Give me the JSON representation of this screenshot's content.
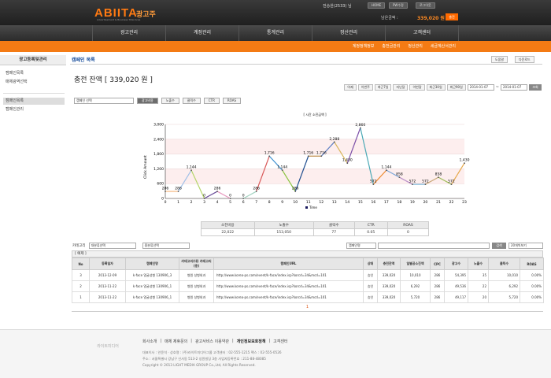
{
  "header": {
    "logo": "ABIITA",
    "logo_sub": "Advertisement & Business Total Area",
    "logo_ko": "광고주",
    "user": "전승완(2533) 님",
    "buttons": [
      "HOME",
      "PW수정",
      "로그아웃"
    ],
    "balance_label": "남은금액 :",
    "balance_value": "339,020 원",
    "charge": "충전"
  },
  "gnb": [
    "광고관리",
    "계정관리",
    "통계관리",
    "정산관리",
    "고객센터"
  ],
  "subnav": [
    "계정정책정보",
    "충전금관리",
    "정산관리",
    "세금계산서관리"
  ],
  "lnb": {
    "title": "광고등록및관리",
    "items": [
      "캠페인목록",
      "매체광역선택",
      "캠페인목록",
      "캠페인관리"
    ]
  },
  "page": {
    "title": "캠페인 목록",
    "util": [
      "도움말",
      "다운로드"
    ],
    "balance": "충전 잔액 [ 339,020 원 ]"
  },
  "dates": {
    "buttons": [
      "어제",
      "이번주",
      "최근7일",
      "지난달",
      "이번달",
      "최근30일",
      "최근90일"
    ],
    "from": "2014-01-07",
    "tilde": "~",
    "to": "2014-01-07",
    "go": "조회"
  },
  "filter": {
    "select": "캠페인 선택",
    "buttons": [
      "광고비용",
      "노출수",
      "클릭수",
      "CTR",
      "ROAS"
    ]
  },
  "chart_data": {
    "type": "line",
    "title": "[ 시간 소진금액 ]",
    "ylabel": "Click Amount",
    "xlabel": "Time",
    "x": [
      0,
      1,
      2,
      3,
      4,
      5,
      6,
      7,
      8,
      9,
      10,
      11,
      12,
      13,
      14,
      15,
      16,
      17,
      18,
      19,
      20,
      21,
      22,
      23
    ],
    "values": [
      286,
      286,
      1144,
      0,
      286,
      0,
      0,
      286,
      1716,
      1144,
      286,
      1716,
      1716,
      2288,
      1430,
      2860,
      572,
      1144,
      858,
      572,
      572,
      858,
      572,
      1430
    ],
    "labels": [
      "286",
      "286",
      "1,144",
      "0",
      "286",
      "0",
      "0",
      "286",
      "1,716",
      "1,144",
      "286",
      "1,716",
      "1,716",
      "2,288",
      "1,430",
      "2,860",
      "572",
      "1,144",
      "858",
      "572",
      "572",
      "858",
      "572",
      "1,430"
    ],
    "yticks": [
      "0",
      "600",
      "1,200",
      "1,800",
      "2,400",
      "3,000"
    ],
    "ylim": [
      0,
      3000
    ],
    "legend": "Time"
  },
  "summary": {
    "headers": [
      "소진비용",
      "노출수",
      "클릭수",
      "CTR",
      "ROAS"
    ],
    "values": [
      "22,022",
      "153,050",
      "77",
      "0.05",
      "0"
    ]
  },
  "list_ctrl": {
    "category_label": "카테고리",
    "category_select": "대분류선택",
    "sub_select": "중분류선택",
    "right_select": "캠페인명",
    "search_btn": "검색",
    "per_page": "20개씩보기"
  },
  "table": {
    "caption": "[ 예제 ]",
    "headers": [
      "No",
      "등록일자",
      "캠페인명",
      "카테고리(대) 카테고리(중)",
      "캠페인URL",
      "상태",
      "충전잔액",
      "일별공소진액",
      "CPC",
      "광고수",
      "노출수",
      "클릭수",
      "ROAS"
    ],
    "rows": [
      [
        "3",
        "2013-12-09",
        "k-face 얼굴성형 130906_3",
        "병원 성형외과",
        "http://www.korea-ps.com/event/k-face/index.isp?korcd=34&mcd=101",
        "승인",
        "339,020",
        "10,010",
        "286",
        "54,395",
        "35",
        "10,010",
        "0.00%"
      ],
      [
        "2",
        "2013-11-22",
        "k-face 얼굴성형 130906_1",
        "병원 성형외과",
        "http://www.korea-ps.com/event/k-face/index.isp?korcd=34&mcd=101",
        "승인",
        "339,020",
        "6,292",
        "286",
        "49,536",
        "22",
        "6,292",
        "0.00%"
      ],
      [
        "1",
        "2013-11-22",
        "k-face 얼굴성형 130906_1",
        "병원 성형외과",
        "http://www.korea-ps.com/event/k-face/index.isp?korcd=34&mcd=101",
        "승인",
        "339,020",
        "5,720",
        "286",
        "49,117",
        "20",
        "5,720",
        "0.00%"
      ]
    ],
    "page": "1"
  },
  "footer": {
    "links": [
      "회사소개",
      "매체 제휴문의",
      "광고서비스 이용약관",
      "개인정보보호정책",
      "고객센터"
    ],
    "info1": "대표이사 : 안윤석 · 상호명 : (주)라이트미디어그룹 고객센터 : 02-555-1215 팩스 : 02-555-0526",
    "info2": "주소 : 서울특별시 강남구 신사동 513-2 성원빌딩 3층 사업자등록번호 : 211-88-48085",
    "copyright": "Copyright © 2013 LIGHT MEDIA GROUP Co.,Ltd, All Rights Reserved.",
    "logo": "라이트미디어"
  }
}
